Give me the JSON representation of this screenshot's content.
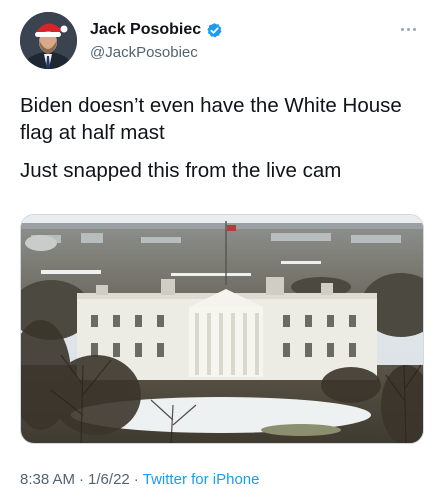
{
  "author": {
    "display_name": "Jack Posobiec",
    "handle": "@JackPosobiec",
    "verified": true,
    "avatar_icon": "profile-photo-santa-hat"
  },
  "tweet": {
    "lines": [
      "Biden doesn’t even have the White House flag at half mast",
      "Just snapped this from the live cam"
    ]
  },
  "media": {
    "description_icon": "white-house-live-cam-photo"
  },
  "meta": {
    "time": "8:38 AM",
    "date": "1/6/22",
    "separator": "·",
    "source": "Twitter for iPhone"
  },
  "colors": {
    "text": "#0f1419",
    "secondary": "#536471",
    "accent": "#1d9bf0"
  }
}
